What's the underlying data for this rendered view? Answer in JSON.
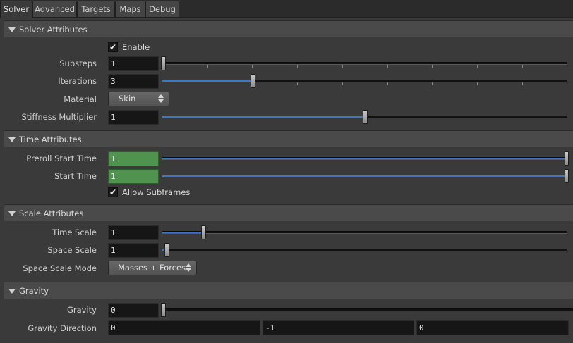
{
  "tabs": [
    {
      "label": "Solver",
      "active": true
    },
    {
      "label": "Advanced",
      "active": false
    },
    {
      "label": "Targets",
      "active": false
    },
    {
      "label": "Maps",
      "active": false
    },
    {
      "label": "Debug",
      "active": false
    }
  ],
  "solver_attributes": {
    "title": "Solver Attributes",
    "enable": {
      "label": "Enable",
      "checked": true,
      "glyph": "✔"
    },
    "substeps": {
      "label": "Substeps",
      "value": "1",
      "slider_fraction": 0.0
    },
    "iterations": {
      "label": "Iterations",
      "value": "3",
      "slider_fraction": 0.22
    },
    "material": {
      "label": "Material",
      "value": "Skin"
    },
    "stiffness_multiplier": {
      "label": "Stiffness Multiplier",
      "value": "1",
      "slider_fraction": 0.5
    }
  },
  "time_attributes": {
    "title": "Time Attributes",
    "preroll_start_time": {
      "label": "Preroll Start Time",
      "value": "1",
      "slider_fraction": 1.0
    },
    "start_time": {
      "label": "Start Time",
      "value": "1",
      "slider_fraction": 1.0
    },
    "allow_subframes": {
      "label": "Allow Subframes",
      "checked": true,
      "glyph": "✔"
    }
  },
  "scale_attributes": {
    "title": "Scale Attributes",
    "time_scale": {
      "label": "Time Scale",
      "value": "1",
      "slider_fraction": 0.1
    },
    "space_scale": {
      "label": "Space Scale",
      "value": "1",
      "slider_fraction": 0.01
    },
    "space_scale_mode": {
      "label": "Space Scale Mode",
      "value": "Masses + Forces"
    }
  },
  "gravity": {
    "title": "Gravity",
    "gravity": {
      "label": "Gravity",
      "value": "0",
      "slider_fraction": 0.0
    },
    "gravity_direction": {
      "label": "Gravity Direction",
      "x": "0",
      "y": "-1",
      "z": "0"
    }
  },
  "colors": {
    "accent_fill": "#3b77c6",
    "green_field": "#4f934f",
    "background": "#3a3a3a",
    "section_header": "#4a4a4a"
  }
}
